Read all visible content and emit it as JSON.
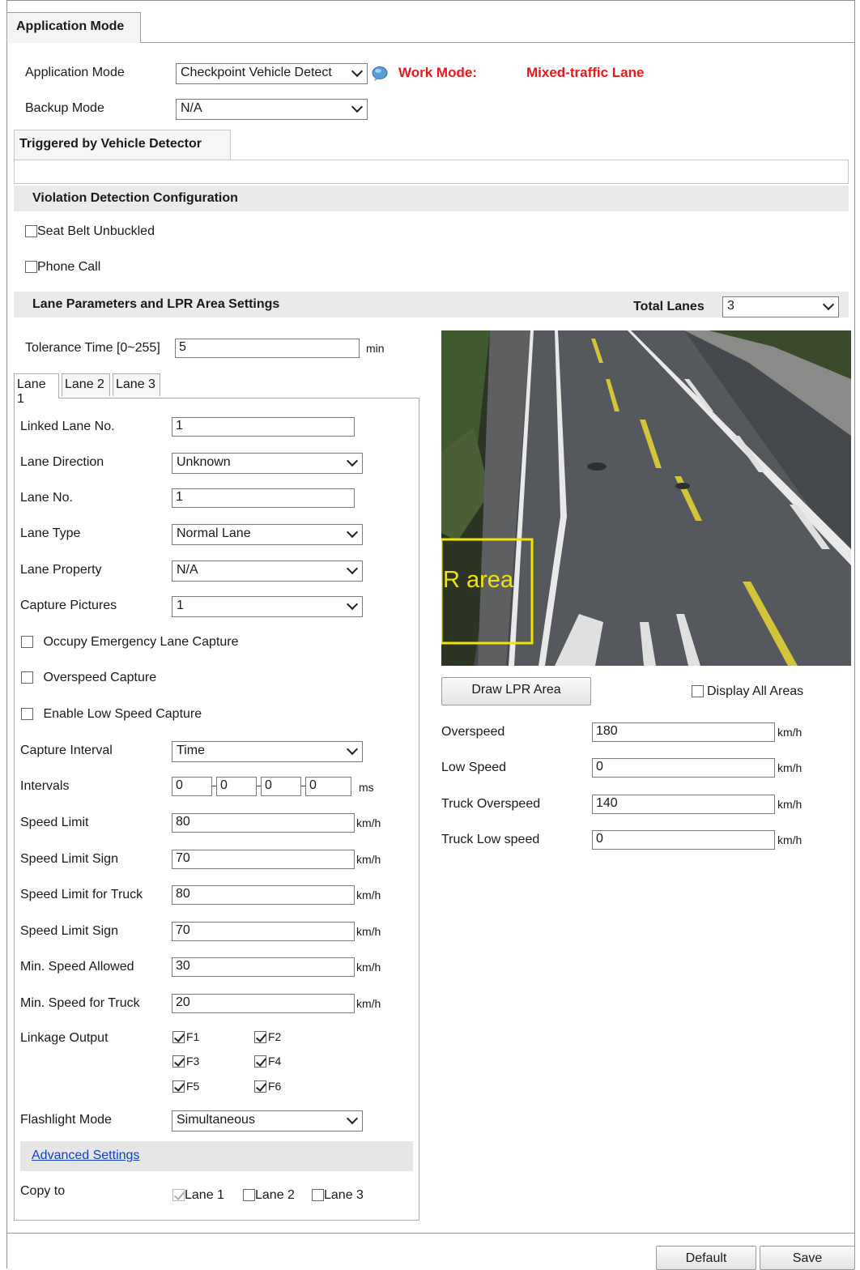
{
  "tab": "Application Mode",
  "app": {
    "mode_label": "Application Mode",
    "mode_value": "Checkpoint Vehicle Detect",
    "work_mode_label": "Work Mode:",
    "work_mode_value": "Mixed-traffic Lane",
    "backup_label": "Backup Mode",
    "backup_value": "N/A"
  },
  "trigger_tab": "Triggered by Vehicle Detector",
  "violation": {
    "title": "Violation Detection Configuration",
    "seat_belt": "Seat Belt Unbuckled",
    "phone_call": "Phone Call"
  },
  "lane_section": {
    "title": "Lane Parameters and LPR Area Settings",
    "total_lanes_label": "Total Lanes",
    "total_lanes_value": "3",
    "tolerance_label": "Tolerance Time [0~255]",
    "tolerance_value": "5",
    "tolerance_unit": "min"
  },
  "lane_tabs": [
    "Lane 1",
    "Lane 2",
    "Lane 3"
  ],
  "lane": {
    "linked_label": "Linked Lane No.",
    "linked_value": "1",
    "direction_label": "Lane Direction",
    "direction_value": "Unknown",
    "no_label": "Lane No.",
    "no_value": "1",
    "type_label": "Lane Type",
    "type_value": "Normal Lane",
    "property_label": "Lane Property",
    "property_value": "N/A",
    "capture_label": "Capture Pictures",
    "capture_value": "1",
    "emergency": "Occupy Emergency Lane Capture",
    "overspeed_cap": "Overspeed Capture",
    "lowspeed_cap": "Enable Low Speed Capture",
    "interval_label": "Capture Interval",
    "interval_value": "Time",
    "intervals_label": "Intervals",
    "intervals": [
      "0",
      "0",
      "0",
      "0"
    ],
    "intervals_unit": "ms",
    "speed_limit_label": "Speed Limit",
    "speed_limit": "80",
    "sign_label": "Speed Limit Sign",
    "sign": "70",
    "truck_limit_label": "Speed Limit for Truck",
    "truck_limit": "80",
    "sign2_label": "Speed Limit Sign",
    "sign2": "70",
    "min_label": "Min. Speed Allowed",
    "min": "30",
    "min_truck_label": "Min. Speed for Truck",
    "min_truck": "20",
    "unit": "km/h",
    "linkage_label": "Linkage Output",
    "linkage": [
      "F1",
      "F2",
      "F3",
      "F4",
      "F5",
      "F6"
    ],
    "flash_label": "Flashlight Mode",
    "flash_value": "Simultaneous",
    "advanced": "Advanced Settings",
    "copy_label": "Copy to",
    "copy": [
      "Lane 1",
      "Lane 2",
      "Lane 3"
    ]
  },
  "preview": {
    "lpr_text": "R area",
    "draw_button": "Draw LPR Area",
    "display_all": "Display All Areas"
  },
  "speeds": {
    "overspeed_label": "Overspeed",
    "overspeed": "180",
    "low_label": "Low Speed",
    "low": "0",
    "truck_over_label": "Truck Overspeed",
    "truck_over": "140",
    "truck_low_label": "Truck Low speed",
    "truck_low": "0",
    "unit": "km/h"
  },
  "footer": {
    "default": "Default",
    "save": "Save"
  }
}
